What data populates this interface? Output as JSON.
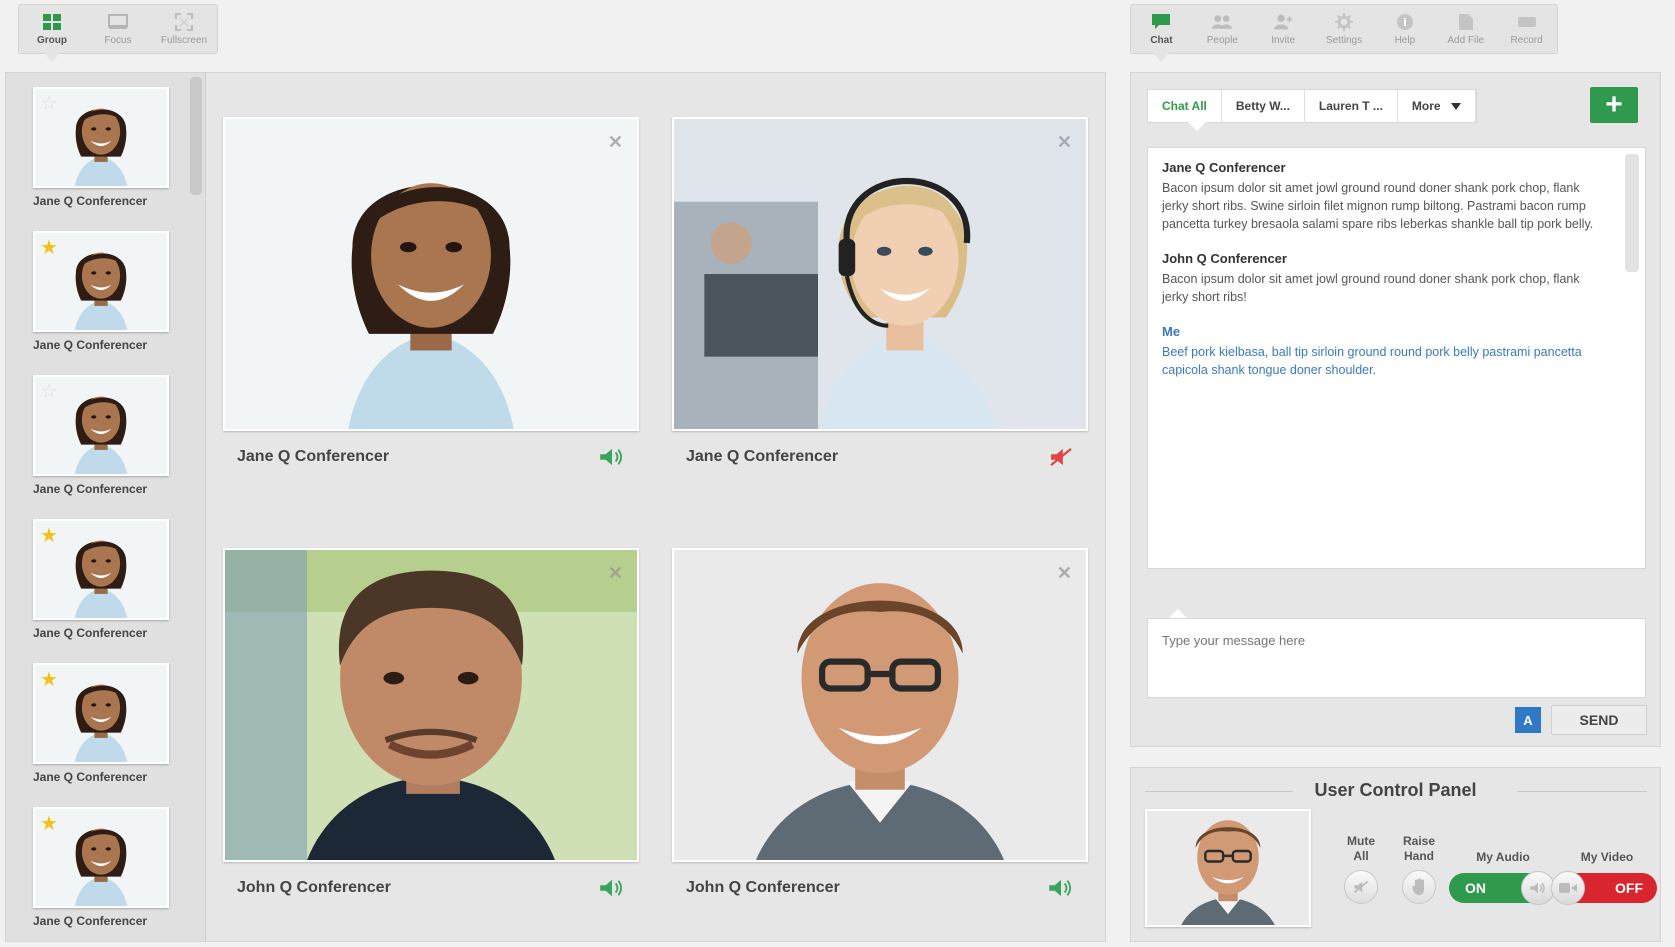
{
  "left_toolbar": {
    "items": [
      {
        "label": "Group",
        "icon": "grid-icon",
        "active": true
      },
      {
        "label": "Focus",
        "icon": "focus-icon",
        "active": false
      },
      {
        "label": "Fullscreen",
        "icon": "fullscreen-icon",
        "active": false
      }
    ]
  },
  "right_toolbar": {
    "items": [
      {
        "label": "Chat",
        "icon": "chat-icon",
        "active": true
      },
      {
        "label": "People",
        "icon": "people-icon",
        "active": false
      },
      {
        "label": "Invite",
        "icon": "invite-icon",
        "active": false
      },
      {
        "label": "Settings",
        "icon": "gear-icon",
        "active": false
      },
      {
        "label": "Help",
        "icon": "help-icon",
        "active": false
      },
      {
        "label": "Add File",
        "icon": "file-icon",
        "active": false
      },
      {
        "label": "Record",
        "icon": "record-icon",
        "active": false
      }
    ]
  },
  "thumbnails": [
    {
      "name": "Jane Q Conferencer",
      "starred": false
    },
    {
      "name": "Jane Q Conferencer",
      "starred": true
    },
    {
      "name": "Jane Q Conferencer",
      "starred": false
    },
    {
      "name": "Jane Q Conferencer",
      "starred": true
    },
    {
      "name": "Jane Q Conferencer",
      "starred": true
    },
    {
      "name": "Jane Q Conferencer",
      "starred": true
    }
  ],
  "tiles": [
    {
      "name": "Jane Q Conferencer",
      "audio": "on"
    },
    {
      "name": "Jane Q Conferencer",
      "audio": "muted"
    },
    {
      "name": "John Q Conferencer",
      "audio": "on"
    },
    {
      "name": "John Q Conferencer",
      "audio": "on"
    }
  ],
  "chat": {
    "tabs": [
      {
        "label": "Chat All",
        "active": true
      },
      {
        "label": "Betty W...",
        "active": false
      },
      {
        "label": "Lauren T ...",
        "active": false
      },
      {
        "label": "More",
        "active": false
      }
    ],
    "messages": [
      {
        "author": "Jane Q Conferencer",
        "text": "Bacon ipsum dolor sit amet jowl ground round doner shank pork chop, flank jerky short ribs. Swine sirloin filet mignon rump biltong. Pastrami bacon rump pancetta turkey bresaola salami spare ribs leberkas shankle ball tip pork belly.",
        "me": false
      },
      {
        "author": "John Q Conferencer",
        "text": "Bacon ipsum dolor sit amet jowl ground round doner shank pork chop, flank jerky short ribs!",
        "me": false
      },
      {
        "author": "Me",
        "text": "Beef pork kielbasa, ball tip sirloin ground round pork belly pastrami pancetta capicola shank tongue doner shoulder.",
        "me": true
      }
    ],
    "input_placeholder": "Type your message here",
    "format_label": "A",
    "send_label": "SEND",
    "add_label": "+"
  },
  "control_panel": {
    "title": "User Control Panel",
    "mute_all": "Mute All",
    "mute_all_line1": "Mute",
    "mute_all_line2": "All",
    "raise_hand_line1": "Raise",
    "raise_hand_line2": "Hand",
    "my_audio": "My Audio",
    "my_audio_state": "ON",
    "my_video": "My Video",
    "my_video_state": "OFF"
  },
  "colors": {
    "accent_green": "#2f9a4e",
    "accent_blue": "#2f79c7",
    "me_text": "#3a78c8",
    "off_red": "#d9262e",
    "star": "#f2c21a"
  }
}
